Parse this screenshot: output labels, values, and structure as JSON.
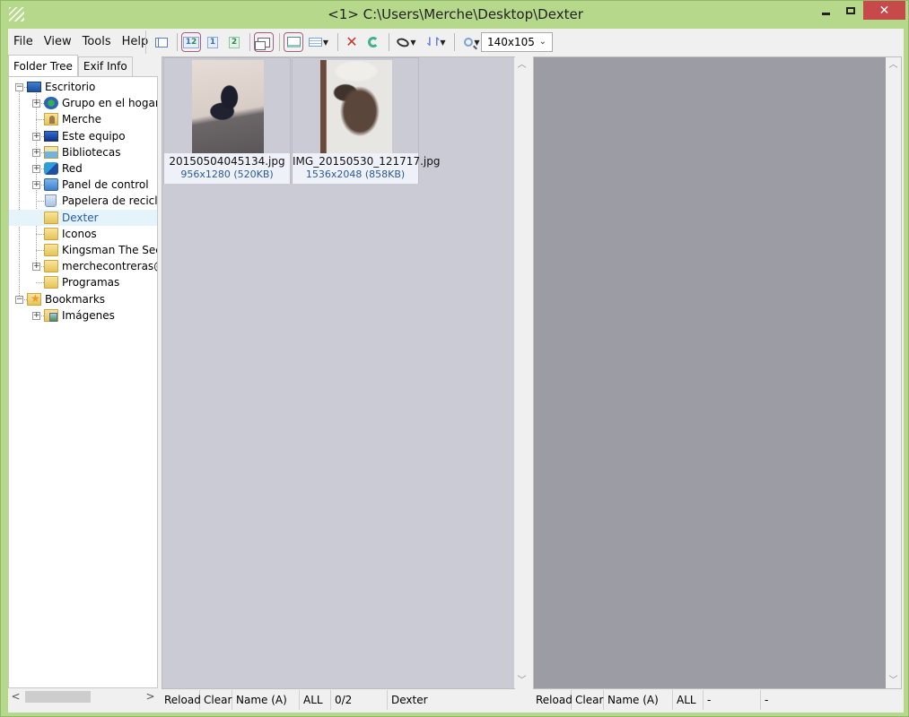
{
  "window": {
    "title": "<1> C:\\Users\\Merche\\Desktop\\Dexter",
    "minimize_label": "",
    "maximize_label": "",
    "close_label": "✕"
  },
  "menu": [
    "File",
    "View",
    "Tools",
    "Help"
  ],
  "toolbar": {
    "buttons": [
      {
        "name": "toggle-tree-panel",
        "icon": "panel-icon"
      },
      {
        "name": "dual-pane",
        "icon": "pane-1-2-icon",
        "checked": true
      },
      {
        "name": "pane-1",
        "icon": "pane-1-icon"
      },
      {
        "name": "pane-2",
        "icon": "pane-2-icon"
      },
      {
        "name": "thumbnail-view",
        "icon": "thumbnail-icon",
        "checked": true
      },
      {
        "name": "preview-view",
        "icon": "preview-icon",
        "checked": true
      },
      {
        "name": "list-view",
        "icon": "list-icon",
        "dropdown": true
      },
      {
        "name": "delete",
        "icon": "delete-x-icon"
      },
      {
        "name": "reload",
        "icon": "reload-icon"
      },
      {
        "name": "filter",
        "icon": "ellipse-icon",
        "dropdown": true
      },
      {
        "name": "sort",
        "icon": "sort-icon",
        "dropdown": true
      },
      {
        "name": "zoom",
        "icon": "magnifier-icon",
        "dropdown": true
      }
    ],
    "pane1_label": "1",
    "pane2_label": "2",
    "thumb_size": "140x105"
  },
  "tabs": [
    {
      "label": "Folder Tree",
      "active": true
    },
    {
      "label": "Exif Info",
      "active": false
    }
  ],
  "tree": [
    {
      "label": "Escritorio",
      "icon": "desktop",
      "level": 0,
      "expander": "-"
    },
    {
      "label": "Grupo en el hogar",
      "icon": "homegroup",
      "level": 1,
      "expander": "+"
    },
    {
      "label": "Merche",
      "icon": "user",
      "level": 1,
      "expander": ""
    },
    {
      "label": "Este equipo",
      "icon": "computer",
      "level": 1,
      "expander": "+"
    },
    {
      "label": "Bibliotecas",
      "icon": "libraries",
      "level": 1,
      "expander": "+"
    },
    {
      "label": "Red",
      "icon": "network",
      "level": 1,
      "expander": "+"
    },
    {
      "label": "Panel de control",
      "icon": "control",
      "level": 1,
      "expander": "+"
    },
    {
      "label": "Papelera de reciclaj",
      "icon": "recycle",
      "level": 1,
      "expander": ""
    },
    {
      "label": "Dexter",
      "icon": "folder",
      "level": 1,
      "expander": "",
      "selected": true
    },
    {
      "label": "Iconos",
      "icon": "folder",
      "level": 1,
      "expander": ""
    },
    {
      "label": "Kingsman The Secr",
      "icon": "folder",
      "level": 1,
      "expander": ""
    },
    {
      "label": "merchecontreras@l",
      "icon": "folder",
      "level": 1,
      "expander": "+"
    },
    {
      "label": "Programas",
      "icon": "folder",
      "level": 1,
      "expander": ""
    },
    {
      "label": "Bookmarks",
      "icon": "bookmark",
      "level": 0,
      "expander": "-"
    },
    {
      "label": "Imágenes",
      "icon": "images",
      "level": 1,
      "expander": "+"
    }
  ],
  "scroll": {
    "left": "<",
    "right": ">",
    "up": "^",
    "down": "v"
  },
  "thumbnails": [
    {
      "filename": "20150504045134.jpg",
      "info": "956x1280 (520KB)"
    },
    {
      "filename": "IMG_20150530_121717.jpg",
      "info": "1536x2048 (858KB)"
    }
  ],
  "status_left": [
    "Reload",
    "Clear",
    "Name (A)",
    "ALL",
    "0/2",
    "Dexter"
  ],
  "status_right": [
    "Reload",
    "Clear",
    "Name (A)",
    "ALL",
    "-",
    "-"
  ]
}
